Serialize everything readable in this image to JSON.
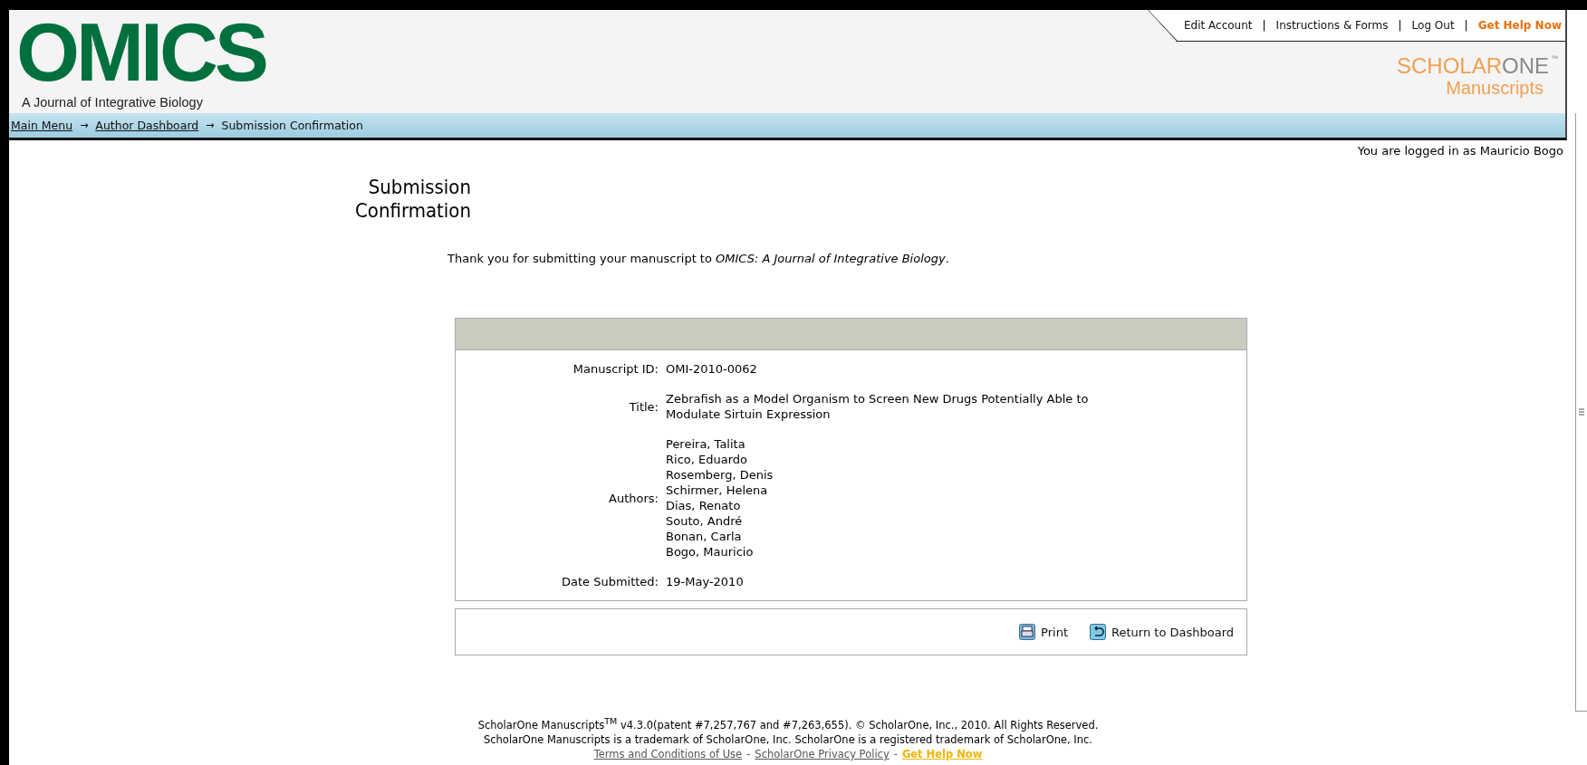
{
  "header": {
    "logo": "OMICS",
    "journal": "A Journal of Integrative Biology",
    "top_links": [
      {
        "label": "Edit Account",
        "kind": "link"
      },
      {
        "label": "Instructions & Forms",
        "kind": "link"
      },
      {
        "label": "Log Out",
        "kind": "link"
      },
      {
        "label": "Get Help Now",
        "kind": "help"
      }
    ],
    "link_separator": "|",
    "brand": {
      "part1": "SCHOLAR",
      "part2": "ONE",
      "tm": "™",
      "product": "Manuscripts"
    }
  },
  "breadcrumb": [
    {
      "label": "Main Menu",
      "kind": "link"
    },
    {
      "label": "Author Dashboard",
      "kind": "link"
    },
    {
      "label": "Submission Confirmation",
      "kind": "current"
    }
  ],
  "breadcrumb_separator": "→",
  "logged_in": "You are logged in as Mauricio Bogo",
  "page_title": "Submission Confirmation",
  "thank_you": "Thank you for submitting your manuscript to *OMICS: A Journal of Integrative Biology*.",
  "details": [
    {
      "label": "Manuscript ID:",
      "lines": [
        "OMI-2010-0062"
      ]
    },
    {
      "label": "Title:",
      "lines": [
        "Zebrafish as a Model Organism to Screen New Drugs Potentially Able to",
        "Modulate Sirtuin Expression"
      ]
    },
    {
      "label": "Authors:",
      "lines": [
        "Pereira, Talita",
        "Rico, Eduardo",
        "Rosemberg, Denis",
        "Schirmer, Helena",
        "Dias, Renato",
        "Souto, André",
        "Bonan, Carla",
        "Bogo, Mauricio"
      ]
    },
    {
      "label": "Date Submitted:",
      "lines": [
        "19-May-2010"
      ]
    }
  ],
  "actions": [
    {
      "label": "Print",
      "kind": "print"
    },
    {
      "label": "Return to Dashboard",
      "kind": "return"
    }
  ],
  "footer": {
    "lines": [
      "ScholarOne Manuscripts$^{TM}$ v4.3.0(patent #7,257,767 and #7,263,655). © ScholarOne, Inc., 2010. All Rights Reserved.",
      "ScholarOne Manuscripts is a trademark of ScholarOne, Inc. ScholarOne is a registered trademark of ScholarOne, Inc."
    ],
    "links": [
      {
        "label": "Terms and Conditions of Use",
        "kind": "link"
      },
      {
        "label": "ScholarOne Privacy Policy",
        "kind": "link"
      },
      {
        "label": "Get Help Now",
        "kind": "help"
      }
    ],
    "separator": "-"
  }
}
